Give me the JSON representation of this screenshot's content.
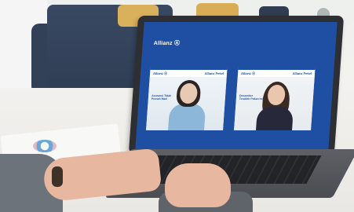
{
  "screen": {
    "brand_label": "Allianz Ⓐ",
    "tiles": [
      {
        "left_brand": "Allianz Ⓐ",
        "right_label": "Allianz Pekel",
        "caption": "Asuransi Tidak Pernah Mati"
      },
      {
        "left_brand": "Allianz Ⓐ",
        "right_label": "Allianz Pekel",
        "caption": "Desember Terakhir Pekan Ini"
      }
    ]
  }
}
